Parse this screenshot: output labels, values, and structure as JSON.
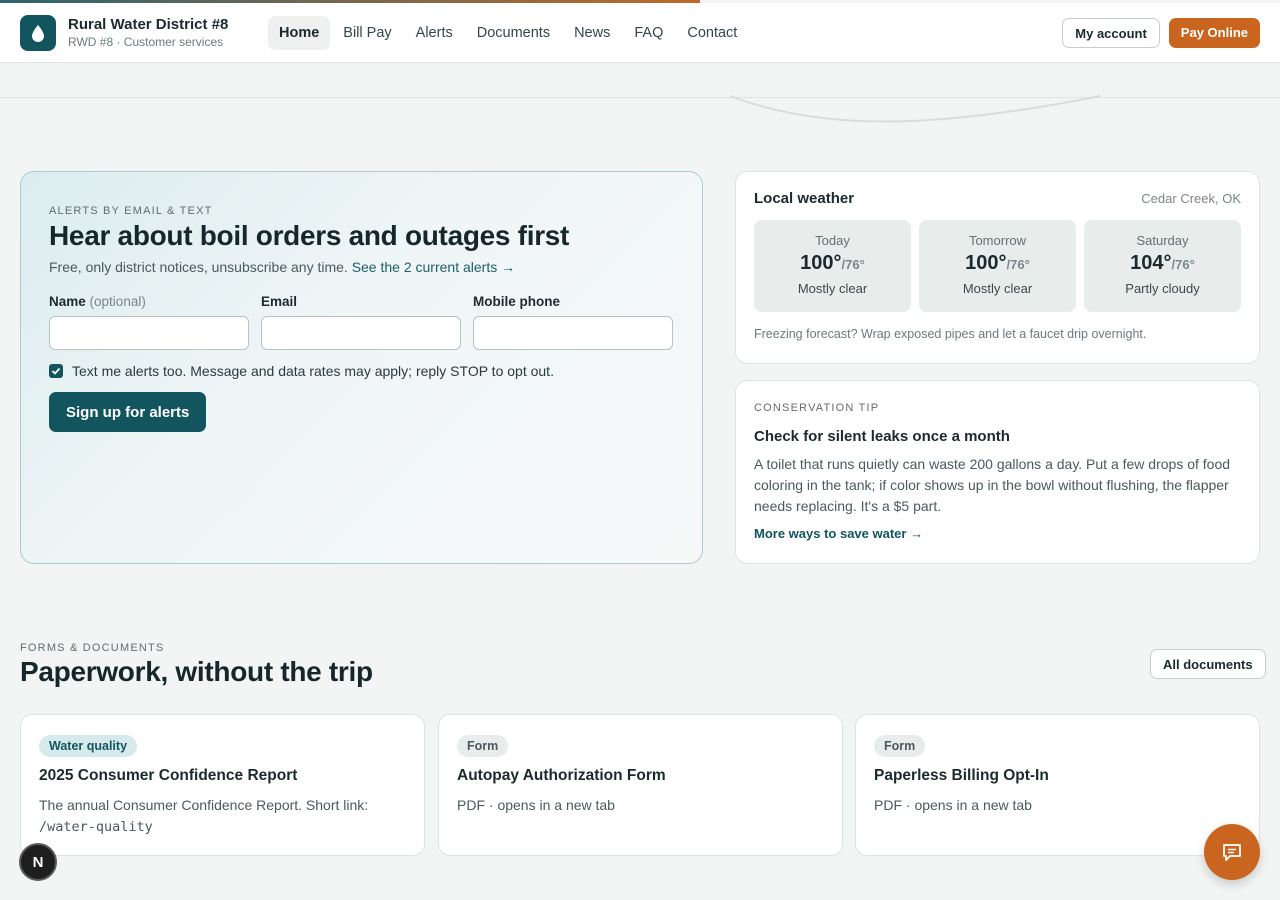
{
  "brand": {
    "name": "Rural Water District #8",
    "subtitle": "RWD #8 · Customer services"
  },
  "nav": [
    {
      "label": "Home",
      "active": true
    },
    {
      "label": "Bill Pay"
    },
    {
      "label": "Alerts"
    },
    {
      "label": "Documents"
    },
    {
      "label": "News"
    },
    {
      "label": "FAQ"
    },
    {
      "label": "Contact"
    }
  ],
  "header_actions": {
    "account": "My account",
    "pay": "Pay Online"
  },
  "signup": {
    "eyebrow": "ALERTS BY EMAIL & TEXT",
    "title": "Hear about boil orders and outages first",
    "lead": "Free, only district notices, unsubscribe any time.",
    "lead_link": "See the 2 current alerts →",
    "name_label": "Name",
    "name_optional": "(optional)",
    "email_label": "Email",
    "phone_label": "Mobile phone",
    "sms_consent": "Text me alerts too. Message and data rates may apply; reply STOP to opt out.",
    "sms_checked": true,
    "submit": "Sign up for alerts"
  },
  "weather": {
    "title": "Local weather",
    "location": "Cedar Creek, OK",
    "days": [
      {
        "name": "Today",
        "high": "100°",
        "low": "/76°",
        "condition": "Mostly clear"
      },
      {
        "name": "Tomorrow",
        "high": "100°",
        "low": "/76°",
        "condition": "Mostly clear"
      },
      {
        "name": "Saturday",
        "high": "104°",
        "low": "/76°",
        "condition": "Partly cloudy"
      }
    ],
    "tip": "Freezing forecast? Wrap exposed pipes and let a faucet drip overnight."
  },
  "conservation": {
    "eyebrow": "CONSERVATION TIP",
    "title": "Check for silent leaks once a month",
    "body": "A toilet that runs quietly can waste 200 gallons a day. Put a few drops of food coloring in the tank; if color shows up in the bowl without flushing, the flapper needs replacing. It's a $5 part.",
    "link": "More ways to save water →"
  },
  "documents": {
    "eyebrow": "FORMS & DOCUMENTS",
    "title": "Paperwork, without the trip",
    "all_button": "All documents",
    "items": [
      {
        "badge": "Water quality",
        "title": "2025 Consumer Confidence Report",
        "desc": "The annual Consumer Confidence Report. Short link:",
        "desc_mono": "/water-quality"
      },
      {
        "badge": "Form",
        "title": "Autopay Authorization Form",
        "desc": "PDF · opens in a new tab"
      },
      {
        "badge": "Form",
        "title": "Paperless Billing Opt-In",
        "desc": "PDF · opens in a new tab"
      }
    ]
  },
  "floating": {
    "n_badge": "N"
  },
  "colors": {
    "primary": "#12555f",
    "accent": "#c9651f",
    "background": "#f3f5f4"
  },
  "icons": {
    "logo": "water-drop-icon",
    "chat": "chat-bubble-icon",
    "check": "checkmark-icon"
  }
}
